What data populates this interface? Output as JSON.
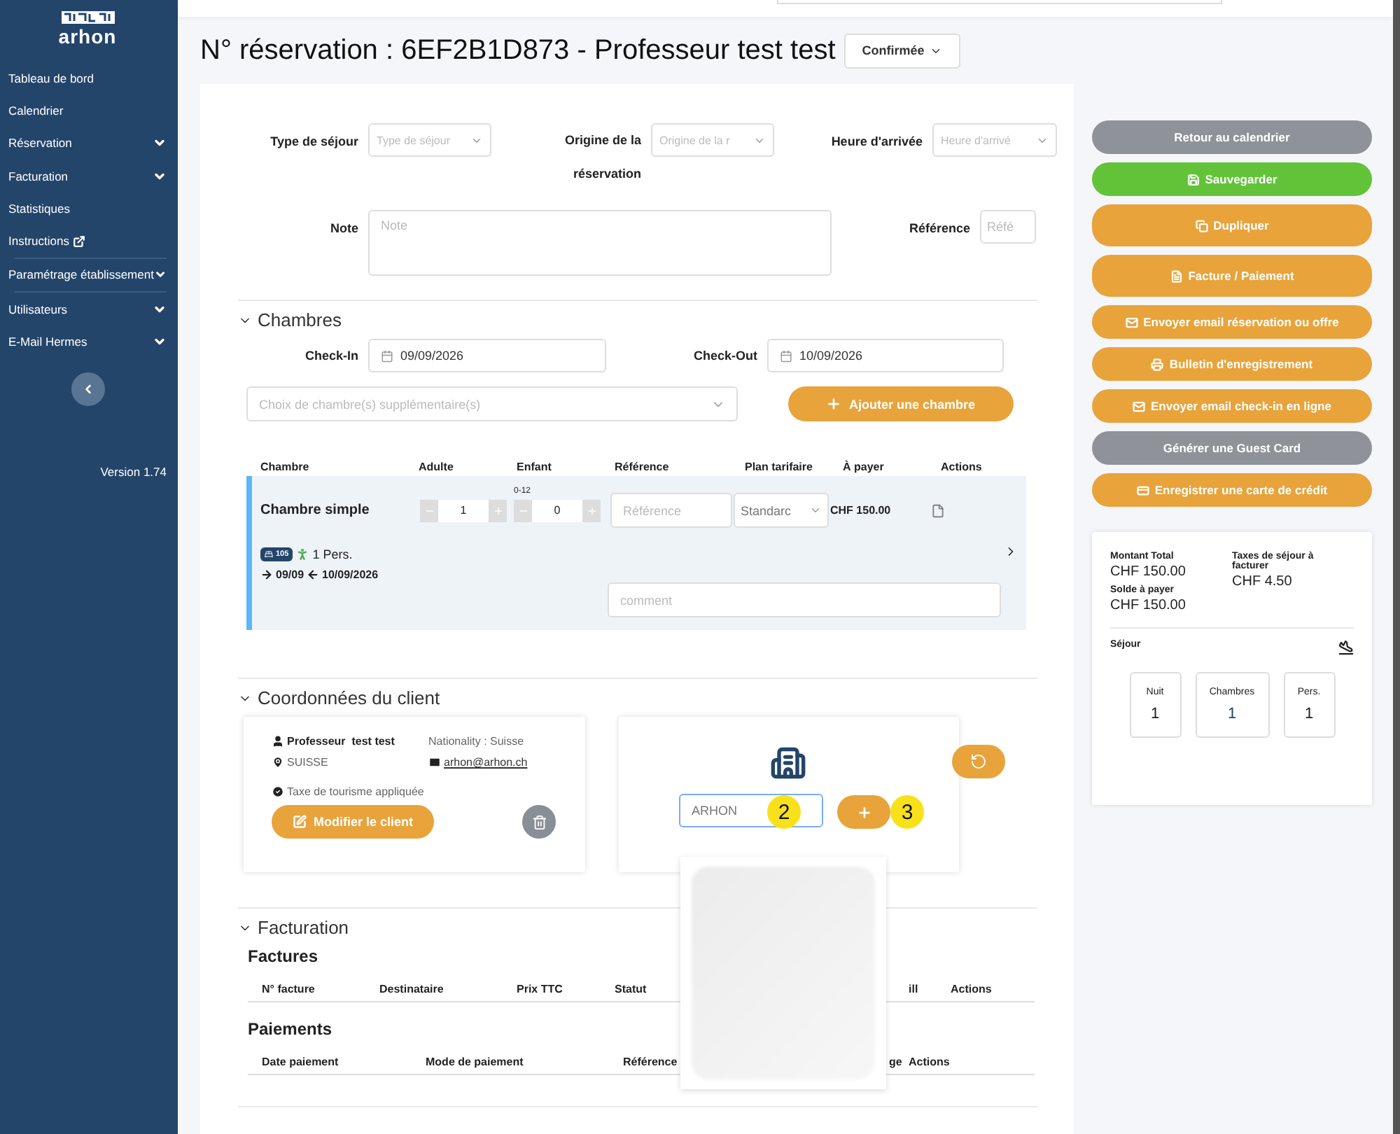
{
  "sidebar": {
    "logo": "arhon",
    "items": [
      {
        "label": "Tableau de bord",
        "kind": "link",
        "divider_after": false
      },
      {
        "label": "Calendrier",
        "kind": "link",
        "divider_after": false
      },
      {
        "label": "Réservation",
        "kind": "menu",
        "divider_after": false
      },
      {
        "label": "Facturation",
        "kind": "menu",
        "divider_after": false
      },
      {
        "label": "Statistiques",
        "kind": "link",
        "divider_after": false
      },
      {
        "label": "Instructions",
        "kind": "external",
        "divider_after": true
      },
      {
        "label": "Paramétrage établissement",
        "kind": "menu",
        "divider_after": true
      },
      {
        "label": "Utilisateurs",
        "kind": "menu",
        "divider_after": false
      },
      {
        "label": "E-Mail Hermes",
        "kind": "menu",
        "divider_after": false
      }
    ],
    "version": "Version 1.74"
  },
  "title": "N° réservation : 6EF2B1D873 - Professeur test test",
  "status": "Confirmée",
  "form": {
    "row_1": [
      {
        "label": "Type de séjour",
        "placeholder": "Type de séjour"
      },
      {
        "label": "Origine de la réservation",
        "placeholder": "Origine de la r"
      },
      {
        "label": "Heure d'arrivée",
        "placeholder": "Heure d'arrivé"
      }
    ],
    "note": {
      "label": "Note",
      "placeholder": "Note"
    },
    "reference": {
      "label": "Référence",
      "placeholder": "Réfé"
    }
  },
  "rooms": {
    "title": "Chambres",
    "expanded": true,
    "check_in": {
      "label": "Check-In",
      "value": "09/09/2026"
    },
    "check_out": {
      "label": "Check-Out",
      "value": "10/09/2026"
    },
    "room_select": {
      "placeholder": "Choix de chambre(s) supplémentaire(s)"
    },
    "add_button": "Ajouter une chambre",
    "columns": [
      "Chambre",
      "Adulte",
      "Enfant",
      "Référence",
      "Plan tarifaire",
      "À payer",
      "Actions"
    ],
    "rows": [
      {
        "name": "Chambre simple",
        "adults": "1",
        "children": "0",
        "children_range": "0-12",
        "reference_placeholder": "Référence",
        "rate_plan": "Standarc",
        "price": "CHF 150.00",
        "room_number": "105",
        "persons": "1 Pers.",
        "arrival": "09/09",
        "departure": "10/09/2026",
        "comment_placeholder": "comment"
      }
    ]
  },
  "client": {
    "title": "Coordonnées du client",
    "expanded": true,
    "name": "Professeur  test test",
    "nationality": "Nationality : Suisse",
    "country": "SUISSE",
    "email": "arhon@arhon.ch",
    "tax": "Taxe de tourisme appliquée",
    "edit_button": "Modifier le client",
    "company_value": "ARHON",
    "markers": [
      "2",
      "3"
    ]
  },
  "billing": {
    "title": "Facturation",
    "expanded": true,
    "invoices": {
      "title": "Factures",
      "columns": [
        "N° facture",
        "Destinataire",
        "Prix TTC",
        "Statut",
        "ill",
        "Actions"
      ]
    },
    "payments": {
      "title": "Paiements",
      "columns": [
        "Date paiement",
        "Mode de paiement",
        "Référence",
        "ge",
        "Actions"
      ]
    }
  },
  "actions": [
    "Retour au calendrier",
    "Sauvegarder",
    "Dupliquer",
    "Facture / Paiement",
    "Envoyer email réservation ou offre",
    "Bulletin d'enregistrement",
    "Envoyer email check-in en ligne",
    "Générer une Guest Card",
    "Enregistrer une carte de crédit"
  ],
  "summary": {
    "totals": [
      {
        "label": "Montant Total",
        "value": "CHF 150.00"
      },
      {
        "label": "Taxes de séjour à facturer",
        "value": "CHF 4.50"
      },
      {
        "label": "Solde à payer",
        "value": "CHF 150.00"
      }
    ],
    "stay_label": "Séjour",
    "stats": [
      {
        "label": "Nuit",
        "value": "1"
      },
      {
        "label": "Chambres",
        "value": "1"
      },
      {
        "label": "Pers.",
        "value": "1"
      }
    ]
  }
}
